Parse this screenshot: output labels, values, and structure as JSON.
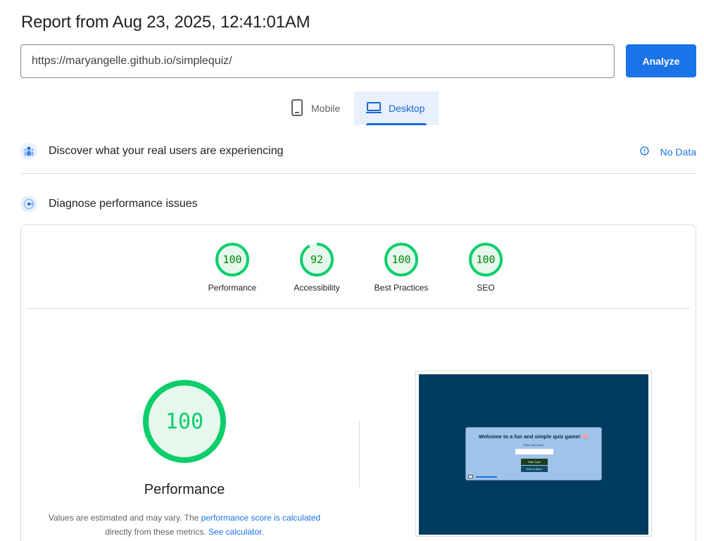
{
  "report": {
    "title": "Report from Aug 23, 2025, 12:41:01AM"
  },
  "search": {
    "url": "https://maryangelle.github.io/simplequiz/",
    "analyze_label": "Analyze"
  },
  "tabs": [
    {
      "label": "Mobile",
      "icon": "smartphone-icon",
      "selected": false
    },
    {
      "label": "Desktop",
      "icon": "laptop-icon",
      "selected": true
    }
  ],
  "crux": {
    "title": "Discover what your real users are experiencing",
    "no_data_label": "No Data"
  },
  "diagnose": {
    "title": "Diagnose performance issues"
  },
  "scores": [
    {
      "label": "Performance",
      "value": "100",
      "fraction": 1.0
    },
    {
      "label": "Accessibility",
      "value": "92",
      "fraction": 0.92
    },
    {
      "label": "Best Practices",
      "value": "100",
      "fraction": 1.0
    },
    {
      "label": "SEO",
      "value": "100",
      "fraction": 1.0
    }
  ],
  "main_gauge": {
    "value": "100",
    "label": "Performance",
    "fraction": 1.0
  },
  "note": {
    "text1": "Values are estimated and may vary. The ",
    "link1": "performance score is calculated",
    "text2": " directly from these metrics. ",
    "link2": "See calculator."
  },
  "screenshot": {
    "title": "Welcome to a fun and simple quiz game! 🧠",
    "input_label": "Enter username:",
    "start_label": "Start Quiz",
    "how_label": "How to play?"
  },
  "colors": {
    "pass": "#0cce6b",
    "pass_bg": "#e6f8ee",
    "pass_text": "#008800",
    "accent": "#1a73e8"
  }
}
